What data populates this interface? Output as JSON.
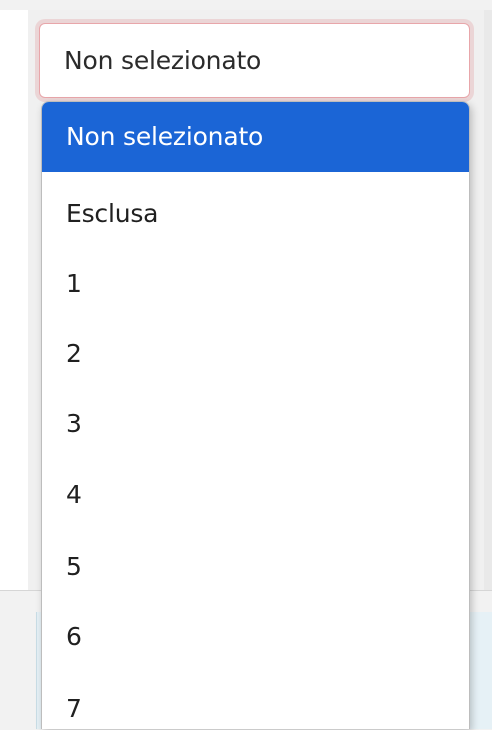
{
  "select": {
    "value": "Non selezionato"
  },
  "dropdown": {
    "options": [
      {
        "label": "Non selezionato",
        "selected": true
      },
      {
        "label": "Esclusa"
      },
      {
        "label": "1"
      },
      {
        "label": "2"
      },
      {
        "label": "3"
      },
      {
        "label": "4"
      },
      {
        "label": "5"
      },
      {
        "label": "6"
      },
      {
        "label": "7"
      }
    ]
  },
  "colors": {
    "selected_option_bg": "#1b65d6",
    "field_border_invalid": "#e8a6aa"
  }
}
